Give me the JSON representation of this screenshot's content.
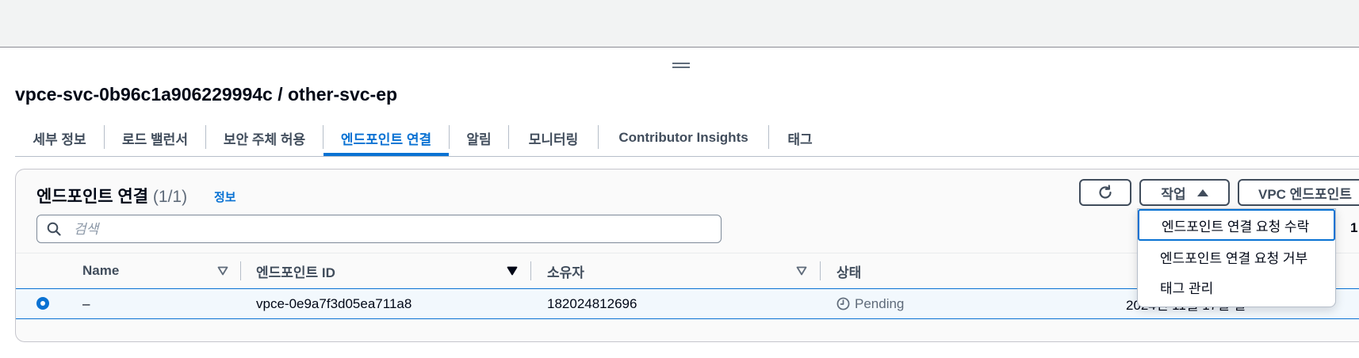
{
  "page": {
    "title": "vpce-svc-0b96c1a906229994c / other-svc-ep"
  },
  "tabs": [
    {
      "label": "세부 정보"
    },
    {
      "label": "로드 밸런서"
    },
    {
      "label": "보안 주체 허용"
    },
    {
      "label": "엔드포인트 연결",
      "active": true
    },
    {
      "label": "알림"
    },
    {
      "label": "모니터링"
    },
    {
      "label": "Contributor Insights"
    },
    {
      "label": "태그"
    }
  ],
  "panel": {
    "title": "엔드포인트 연결",
    "count": "(1/1)",
    "info_link": "정보",
    "search_placeholder": "검색",
    "pagination_page": "1",
    "buttons": {
      "refresh_icon": "refresh-icon",
      "actions_label": "작업",
      "vpc_endpoint_label": "VPC 엔드포인트"
    }
  },
  "table": {
    "columns": [
      {
        "label": "Name",
        "sort": "unsorted"
      },
      {
        "label": "엔드포인트 ID",
        "sort": "descending"
      },
      {
        "label": "소유자",
        "sort": "unsorted"
      },
      {
        "label": "상태"
      }
    ],
    "rows": [
      {
        "selected": true,
        "name": "–",
        "endpoint_id": "vpce-0e9a7f3d05ea711a8",
        "owner": "182024812696",
        "status": "Pending",
        "status_icon": "clock-icon",
        "created_partial": "2024년 11월 17일 일"
      }
    ]
  },
  "actions_menu": {
    "items": [
      {
        "label": "엔드포인트 연결 요청 수락",
        "focused": true
      },
      {
        "label": "엔드포인트 연결 요청 거부"
      },
      {
        "label": "태그 관리"
      }
    ]
  },
  "colors": {
    "accent": "#0972d3",
    "text": "#000716",
    "muted": "#5f6b7a",
    "border": "#b6bec9"
  }
}
